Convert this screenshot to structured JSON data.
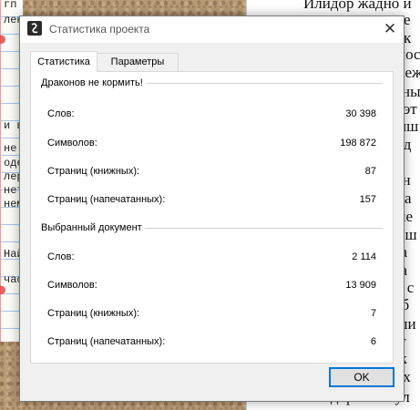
{
  "window": {
    "title": "Статистика проекта",
    "close_glyph": "✕"
  },
  "tabs": [
    {
      "label": "Статистика",
      "active": true
    },
    {
      "label": "Параметры",
      "active": false
    }
  ],
  "project_group": {
    "title": "Драконов не кормить!",
    "rows": [
      {
        "label": "Слов:",
        "value": "30 398"
      },
      {
        "label": "Символов:",
        "value": "198 872"
      },
      {
        "label": "Страниц (книжных):",
        "value": "87"
      },
      {
        "label": "Страниц (напечатанных):",
        "value": "157"
      }
    ]
  },
  "document_group": {
    "title": "Выбранный документ",
    "rows": [
      {
        "label": "Слов:",
        "value": "2 114"
      },
      {
        "label": "Символов:",
        "value": "13 909"
      },
      {
        "label": "Страниц (книжных):",
        "value": "7"
      },
      {
        "label": "Страниц (напечатанных):",
        "value": "6"
      }
    ]
  },
  "buttons": {
    "ok": "OK"
  },
  "background": {
    "right_page_lines": [
      "Илидор жадно и",
      "е",
      "к",
      "пос",
      "леж",
      "ны",
      "эт",
      "иш",
      "а д",
      "он",
      "ка",
      "ле",
      "еш",
      "ра",
      "ра",
      "о с",
      "аб",
      "ли",
      "ат",
      "ак",
      "ых",
      "ыт",
      "Илидор стиснул"
    ],
    "index_card_lines": [
      "ленн",
      "и в",
      "не в",
      "одей",
      "лерег",
      "нет.",
      "нем",
      "Най",
      "час"
    ],
    "index_card_top_line": "гп"
  },
  "colors": {
    "accent": "#0078d7",
    "dialog_bg": "#f0f0f0",
    "stamp": "#dd4444"
  }
}
